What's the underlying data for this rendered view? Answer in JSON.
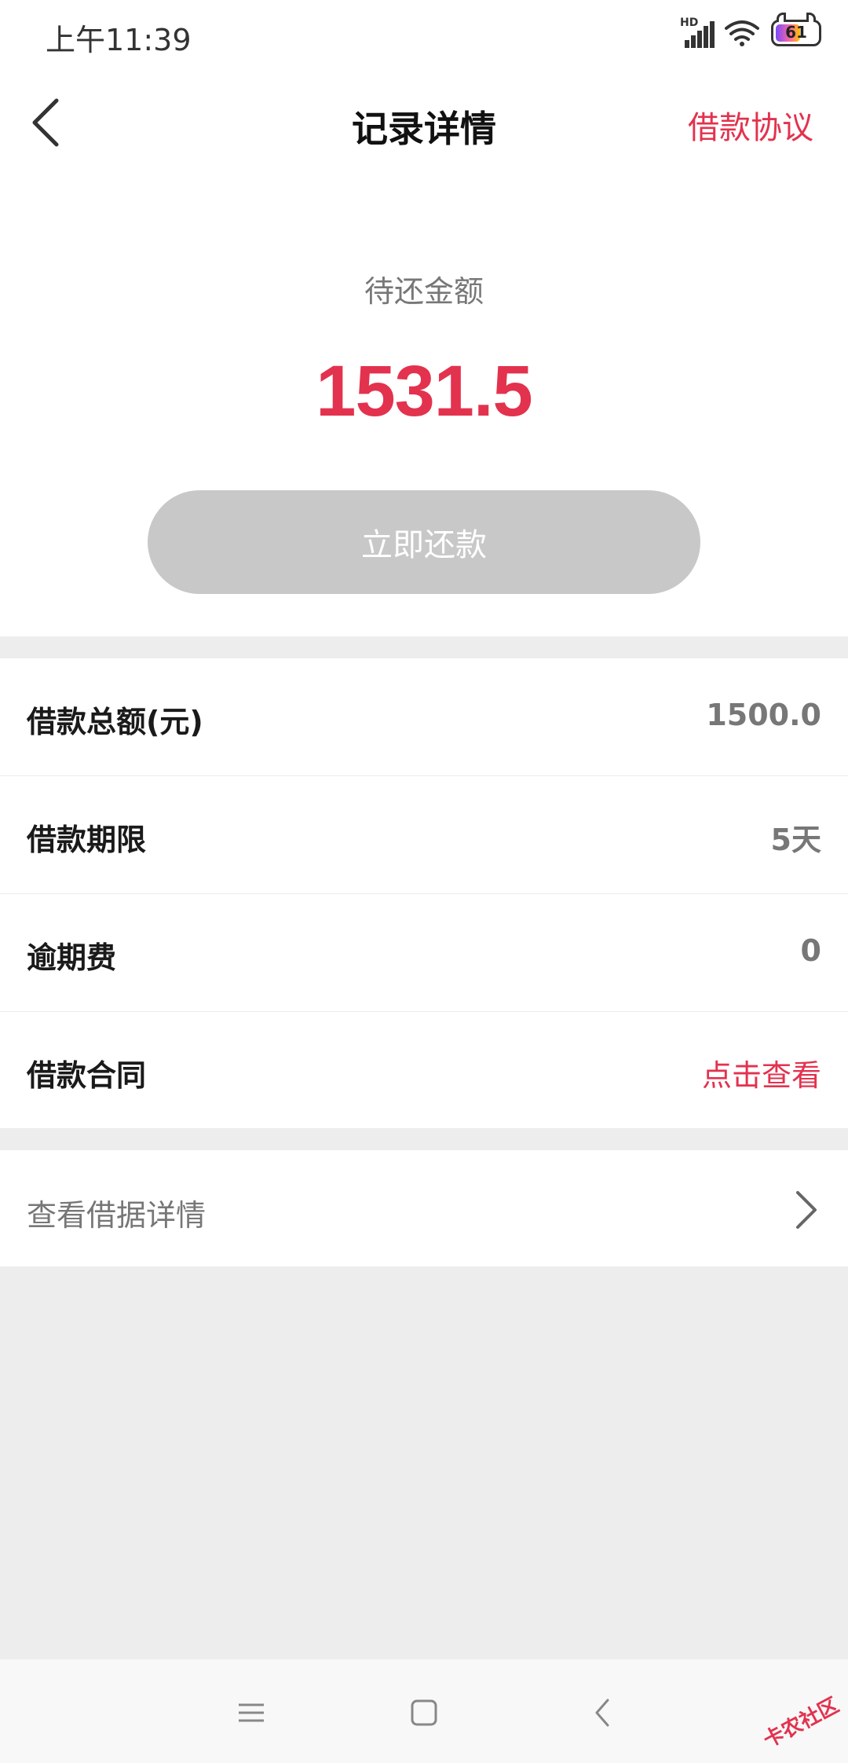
{
  "status_bar": {
    "time": "上午11:39",
    "network_label": "HD",
    "battery_level": "61"
  },
  "header": {
    "title": "记录详情",
    "agreement_link": "借款协议"
  },
  "summary": {
    "label": "待还金额",
    "amount": "1531.5",
    "repay_button": "立即还款"
  },
  "details": [
    {
      "label": "借款总额(元)",
      "value": "1500.0"
    },
    {
      "label": "借款期限",
      "value": "5天"
    },
    {
      "label": "逾期费",
      "value": "0"
    },
    {
      "label": "借款合同",
      "value": "点击查看"
    }
  ],
  "receipt": {
    "label": "查看借据详情"
  },
  "watermark": "卡农社区",
  "colors": {
    "accent": "#e3324e",
    "button_disabled": "#c8c8c8",
    "page_background": "#ededed"
  }
}
